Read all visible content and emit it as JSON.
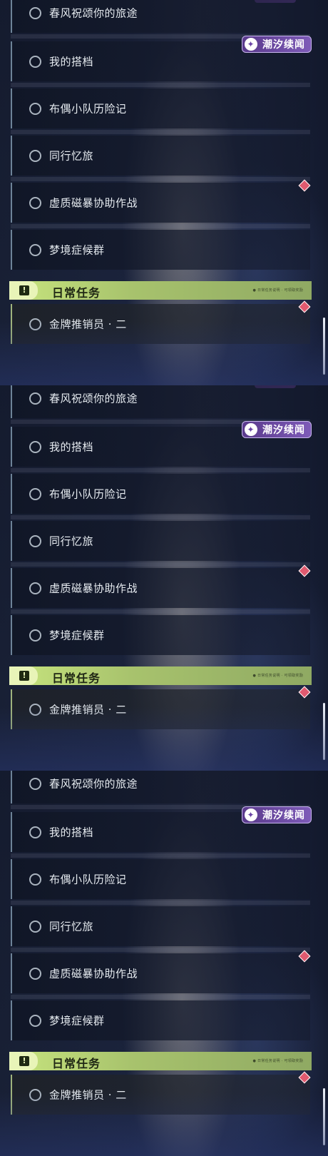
{
  "panels": [
    {
      "badge": {
        "text": "潮汐续闻"
      },
      "quests": [
        "春风祝颂你的旅途",
        "我的搭档",
        "布偶小队历险记",
        "同行忆旅",
        "虚质磁暴协助作战",
        "梦境症候群"
      ],
      "daily": {
        "title": "日常任务",
        "small_text": "● 日常任务说明 · 可领取奖励",
        "quest": "金牌推销员 · 二"
      },
      "badge_icon": "✦"
    },
    {
      "badge": {
        "text": "潮汐续闻"
      },
      "quests": [
        "春风祝颂你的旅途",
        "我的搭档",
        "布偶小队历险记",
        "同行忆旅",
        "虚质磁暴协助作战",
        "梦境症候群"
      ],
      "daily": {
        "title": "日常任务",
        "small_text": "● 日常任务说明 · 可领取奖励",
        "quest": "金牌推销员 · 二"
      },
      "badge_icon": "✦"
    },
    {
      "badge": {
        "text": "潮汐续闻"
      },
      "quests": [
        "春风祝颂你的旅途",
        "我的搭档",
        "布偶小队历险记",
        "同行忆旅",
        "虚质磁暴协助作战",
        "梦境症候群"
      ],
      "daily": {
        "title": "日常任务",
        "small_text": "● 日常任务说明 · 可领取奖励",
        "quest": "金牌推销员 · 二"
      },
      "badge_icon": "✦"
    }
  ],
  "header_icon": "!",
  "colors": {
    "accent_green": "#c7e47e",
    "badge_purple": "#6a43a6",
    "alert_red": "#e05a6f"
  }
}
